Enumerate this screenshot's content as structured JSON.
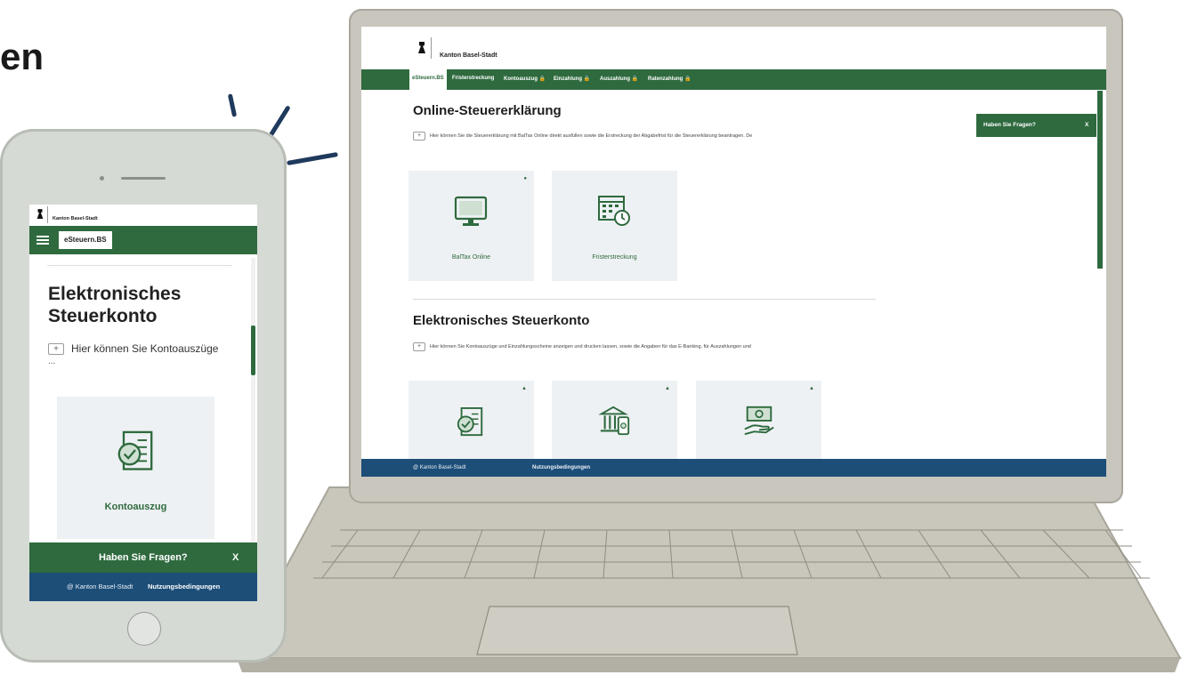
{
  "headline_fragment": "en",
  "laptop": {
    "brand": "Kanton Basel-Stadt",
    "nav": [
      {
        "label": "eSteuern.BS",
        "active": true
      },
      {
        "label": "Fristerstreckung"
      },
      {
        "label": "Kontoauszug 🔒"
      },
      {
        "label": "Einzahlung 🔒"
      },
      {
        "label": "Auszahlung 🔒"
      },
      {
        "label": "Ratenzahlung 🔒"
      }
    ],
    "section1": {
      "title": "Online-Steuererklärung",
      "intro_plus": "+",
      "intro": "Hier können Sie die Steuererklärung mit BalTax Online direkt ausfüllen sowie die Erstreckung der Abgabefrist für die Steuererklärung beantragen. De",
      "tiles": [
        {
          "label": "BalTax Online",
          "icon": "monitor-icon",
          "mark": "●"
        },
        {
          "label": "Fristerstreckung",
          "icon": "calendar-clock-icon",
          "mark": ""
        }
      ]
    },
    "section2": {
      "title": "Elektronisches Steuerkonto",
      "intro_plus": "+",
      "intro": "Hier können Sie Kontoauszüge und Einzahlungsscheine anzeigen und drucken lassen, sowie die Angaben für das E-Banking, für Auszahlungen und",
      "tiles": [
        {
          "icon": "document-check-icon",
          "mark": "▲"
        },
        {
          "icon": "bank-phone-icon",
          "mark": "▲"
        },
        {
          "icon": "money-hand-icon",
          "mark": "▲"
        }
      ]
    },
    "help": {
      "label": "Haben Sie Fragen?",
      "close": "X"
    },
    "footer": {
      "copyright": "@ Kanton Basel-Stadt",
      "terms": "Nutzungsbedingungen"
    }
  },
  "phone": {
    "brand": "Kanton Basel-Stadt",
    "nav_label": "eSteuern.BS",
    "title": "Elektronisches Steuerkonto",
    "intro_plus": "+",
    "intro": "Hier können Sie Kontoauszüge",
    "intro_more": "...",
    "tile": {
      "label": "Kontoauszug",
      "icon": "document-check-icon"
    },
    "help": {
      "label": "Haben Sie Fragen?",
      "close": "X"
    },
    "footer": {
      "copyright": "@ Kanton Basel-Stadt",
      "terms": "Nutzungsbedingungen"
    }
  },
  "colors": {
    "green": "#2e6a3e",
    "blue": "#1d4e78",
    "tile": "#eef1f3"
  }
}
